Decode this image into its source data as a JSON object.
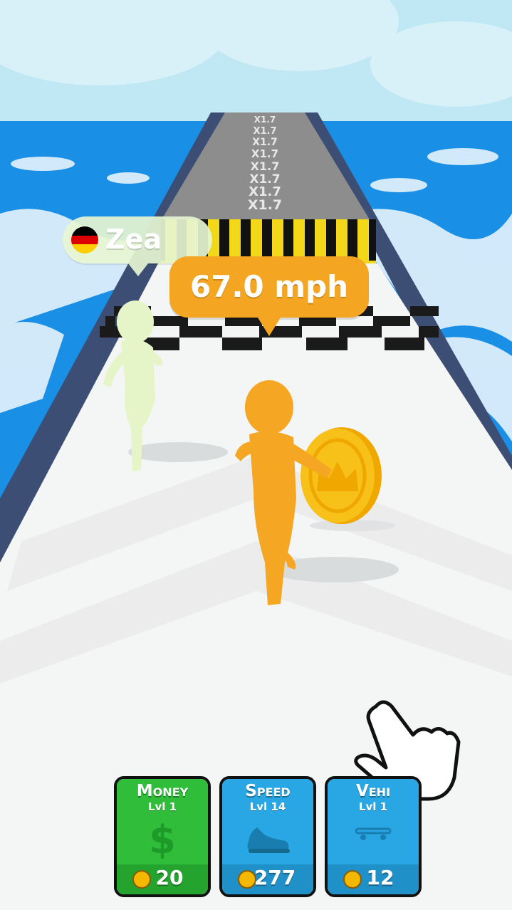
{
  "rival": {
    "name": "Zea",
    "flag": "germany-flag"
  },
  "speed": {
    "text": "67.0 mph"
  },
  "track": {
    "multipliers": [
      "X1.7",
      "X1.7",
      "X1.7",
      "X1.7",
      "X1.7",
      "X1.7",
      "X1.7",
      "X1.7"
    ]
  },
  "upgrades": [
    {
      "title": "Money",
      "level": "Lvl 1",
      "icon": "dollar-icon",
      "price": "20",
      "color": "#2fbd3a"
    },
    {
      "title": "Speed",
      "level": "Lvl 14",
      "icon": "sneaker-icon",
      "price": "277",
      "color": "#29a7e4"
    },
    {
      "title": "Vehi",
      "level": "Lvl 1",
      "icon": "skateboard-icon",
      "price": "12",
      "color": "#29a7e4"
    }
  ],
  "colors": {
    "sky": "#bfe7f4",
    "sea": "#1a8fe6",
    "player": "#f5a623",
    "rival": "#e6f5c8",
    "coin": "#f5b800"
  }
}
